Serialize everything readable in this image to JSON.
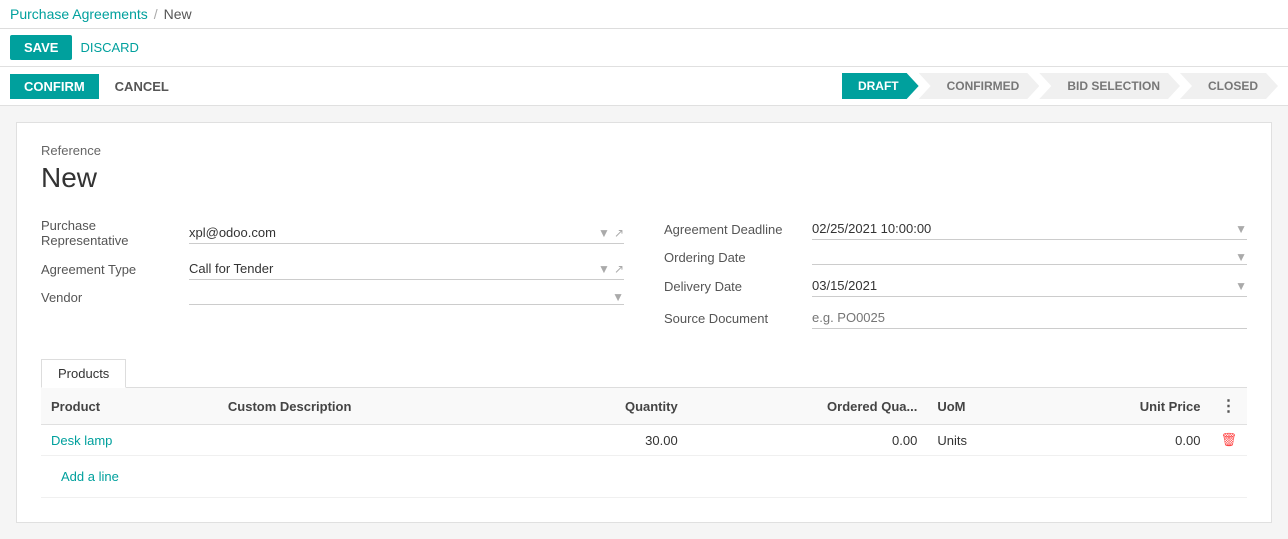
{
  "breadcrumb": {
    "parent": "Purchase Agreements",
    "separator": "/",
    "current": "New"
  },
  "toolbar": {
    "save_label": "SAVE",
    "discard_label": "DISCARD"
  },
  "actions": {
    "confirm_label": "CONFIRM",
    "cancel_label": "CANCEL"
  },
  "status_pipeline": [
    {
      "id": "draft",
      "label": "DRAFT",
      "active": true
    },
    {
      "id": "confirmed",
      "label": "CONFIRMED",
      "active": false
    },
    {
      "id": "bid_selection",
      "label": "BID SELECTION",
      "active": false
    },
    {
      "id": "closed",
      "label": "CLOSED",
      "active": false
    }
  ],
  "form": {
    "reference_label": "Reference",
    "reference_value": "New",
    "purchase_representative_label": "Purchase Representative",
    "purchase_representative_value": "xpl@odoo.com",
    "agreement_type_label": "Agreement Type",
    "agreement_type_value": "Call for Tender",
    "vendor_label": "Vendor",
    "vendor_value": "",
    "agreement_deadline_label": "Agreement Deadline",
    "agreement_deadline_value": "02/25/2021 10:00:00",
    "ordering_date_label": "Ordering Date",
    "ordering_date_value": "",
    "delivery_date_label": "Delivery Date",
    "delivery_date_value": "03/15/2021",
    "source_document_label": "Source Document",
    "source_document_placeholder": "e.g. PO0025"
  },
  "tabs": [
    {
      "id": "products",
      "label": "Products",
      "active": true
    }
  ],
  "table": {
    "columns": [
      {
        "id": "product",
        "label": "Product"
      },
      {
        "id": "description",
        "label": "Custom Description"
      },
      {
        "id": "quantity",
        "label": "Quantity",
        "align": "right"
      },
      {
        "id": "ordered_qty",
        "label": "Ordered Qua...",
        "align": "right"
      },
      {
        "id": "uom",
        "label": "UoM"
      },
      {
        "id": "unit_price",
        "label": "Unit Price",
        "align": "right"
      }
    ],
    "rows": [
      {
        "product": "Desk lamp",
        "description": "",
        "quantity": "30.00",
        "ordered_qty": "0.00",
        "uom": "Units",
        "unit_price": "0.00"
      }
    ],
    "add_line_label": "Add a line"
  }
}
